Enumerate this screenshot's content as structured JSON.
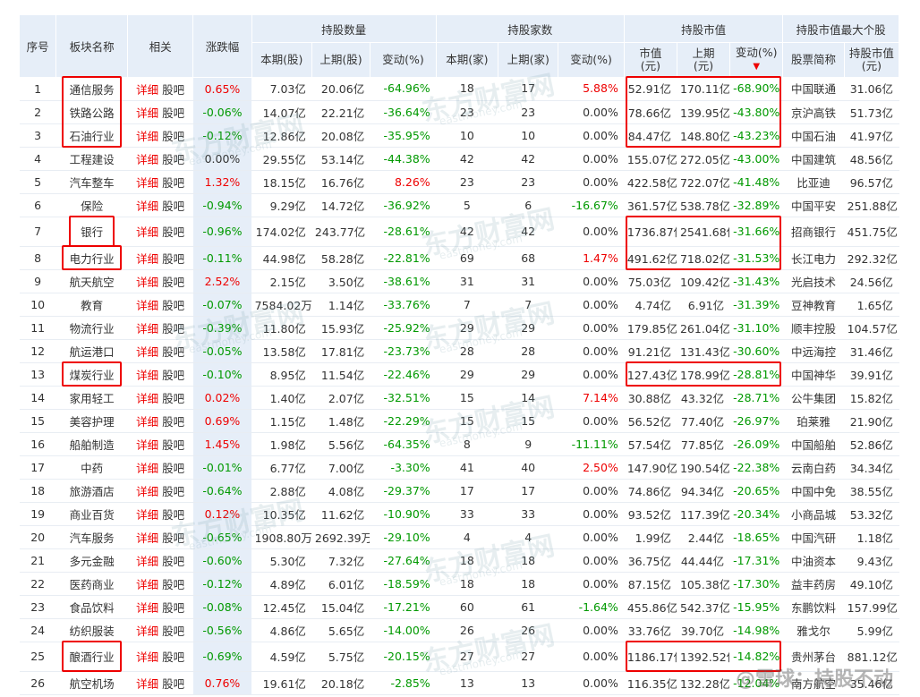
{
  "headers": {
    "seq": "序号",
    "name": "板块名称",
    "related": "相关",
    "change": "涨跌幅",
    "group_shares": "持股数量",
    "group_holders": "持股家数",
    "group_value": "持股市值",
    "group_top": "持股市值最大个股",
    "cur_shares": "本期(股)",
    "prev_shares": "上期(股)",
    "chg_shares": "变动(%)",
    "cur_holders": "本期(家)",
    "prev_holders": "上期(家)",
    "chg_holders": "变动(%)",
    "cur_value_l1": "市值",
    "cur_value_l2": "(元)",
    "prev_value_l1": "上期",
    "prev_value_l2": "(元)",
    "chg_value": "变动(%)",
    "sort_icon": "sort-desc-icon",
    "stock_name": "股票简称",
    "stock_value_l1": "持股市值",
    "stock_value_l2": "(元)"
  },
  "links": {
    "detail": "详细",
    "forum": "股吧"
  },
  "rows": [
    {
      "seq": "1",
      "name": "通信服务",
      "change": "0.65%",
      "cur_shares": "7.03亿",
      "prev_shares": "20.06亿",
      "chg_shares": "-64.96%",
      "cur_holders": "18",
      "prev_holders": "17",
      "chg_holders": "5.88%",
      "cur_value": "52.91亿",
      "prev_value": "170.11亿",
      "chg_value": "-68.90%",
      "stock": "中国联通",
      "stock_value": "31.06亿"
    },
    {
      "seq": "2",
      "name": "铁路公路",
      "change": "-0.06%",
      "cur_shares": "14.07亿",
      "prev_shares": "22.21亿",
      "chg_shares": "-36.64%",
      "cur_holders": "23",
      "prev_holders": "23",
      "chg_holders": "0.00%",
      "cur_value": "78.66亿",
      "prev_value": "139.95亿",
      "chg_value": "-43.80%",
      "stock": "京沪高铁",
      "stock_value": "51.73亿"
    },
    {
      "seq": "3",
      "name": "石油行业",
      "change": "-0.12%",
      "cur_shares": "12.86亿",
      "prev_shares": "20.08亿",
      "chg_shares": "-35.95%",
      "cur_holders": "10",
      "prev_holders": "10",
      "chg_holders": "0.00%",
      "cur_value": "84.47亿",
      "prev_value": "148.80亿",
      "chg_value": "-43.23%",
      "stock": "中国石油",
      "stock_value": "41.97亿"
    },
    {
      "seq": "4",
      "name": "工程建设",
      "change": "0.00%",
      "cur_shares": "29.55亿",
      "prev_shares": "53.14亿",
      "chg_shares": "-44.38%",
      "cur_holders": "42",
      "prev_holders": "42",
      "chg_holders": "0.00%",
      "cur_value": "155.07亿",
      "prev_value": "272.05亿",
      "chg_value": "-43.00%",
      "stock": "中国建筑",
      "stock_value": "48.56亿"
    },
    {
      "seq": "5",
      "name": "汽车整车",
      "change": "1.32%",
      "cur_shares": "18.15亿",
      "prev_shares": "16.76亿",
      "chg_shares": "8.26%",
      "cur_holders": "23",
      "prev_holders": "23",
      "chg_holders": "0.00%",
      "cur_value": "422.58亿",
      "prev_value": "722.07亿",
      "chg_value": "-41.48%",
      "stock": "比亚迪",
      "stock_value": "96.57亿"
    },
    {
      "seq": "6",
      "name": "保险",
      "change": "-0.94%",
      "cur_shares": "9.29亿",
      "prev_shares": "14.72亿",
      "chg_shares": "-36.92%",
      "cur_holders": "5",
      "prev_holders": "6",
      "chg_holders": "-16.67%",
      "cur_value": "361.57亿",
      "prev_value": "538.78亿",
      "chg_value": "-32.89%",
      "stock": "中国平安",
      "stock_value": "251.88亿"
    },
    {
      "seq": "7",
      "name": "银行",
      "change": "-0.96%",
      "cur_shares": "174.02亿",
      "prev_shares": "243.77亿",
      "chg_shares": "-28.61%",
      "cur_holders": "42",
      "prev_holders": "42",
      "chg_holders": "0.00%",
      "cur_value": "1736.87亿",
      "prev_value": "2541.68亿",
      "chg_value": "-31.66%",
      "stock": "招商银行",
      "stock_value": "451.75亿",
      "tall": true
    },
    {
      "seq": "8",
      "name": "电力行业",
      "change": "-0.11%",
      "cur_shares": "44.98亿",
      "prev_shares": "58.28亿",
      "chg_shares": "-22.81%",
      "cur_holders": "69",
      "prev_holders": "68",
      "chg_holders": "1.47%",
      "cur_value": "491.62亿",
      "prev_value": "718.02亿",
      "chg_value": "-31.53%",
      "stock": "长江电力",
      "stock_value": "292.32亿"
    },
    {
      "seq": "9",
      "name": "航天航空",
      "change": "2.52%",
      "cur_shares": "2.15亿",
      "prev_shares": "3.50亿",
      "chg_shares": "-38.61%",
      "cur_holders": "31",
      "prev_holders": "31",
      "chg_holders": "0.00%",
      "cur_value": "75.03亿",
      "prev_value": "109.42亿",
      "chg_value": "-31.43%",
      "stock": "光启技术",
      "stock_value": "24.56亿"
    },
    {
      "seq": "10",
      "name": "教育",
      "change": "-0.07%",
      "cur_shares": "7584.02万",
      "prev_shares": "1.14亿",
      "chg_shares": "-33.76%",
      "cur_holders": "7",
      "prev_holders": "7",
      "chg_holders": "0.00%",
      "cur_value": "4.74亿",
      "prev_value": "6.91亿",
      "chg_value": "-31.39%",
      "stock": "豆神教育",
      "stock_value": "1.65亿"
    },
    {
      "seq": "11",
      "name": "物流行业",
      "change": "-0.39%",
      "cur_shares": "11.80亿",
      "prev_shares": "15.93亿",
      "chg_shares": "-25.92%",
      "cur_holders": "29",
      "prev_holders": "29",
      "chg_holders": "0.00%",
      "cur_value": "179.85亿",
      "prev_value": "261.04亿",
      "chg_value": "-31.10%",
      "stock": "顺丰控股",
      "stock_value": "104.57亿"
    },
    {
      "seq": "12",
      "name": "航运港口",
      "change": "-0.05%",
      "cur_shares": "13.58亿",
      "prev_shares": "17.81亿",
      "chg_shares": "-23.73%",
      "cur_holders": "28",
      "prev_holders": "28",
      "chg_holders": "0.00%",
      "cur_value": "91.21亿",
      "prev_value": "131.43亿",
      "chg_value": "-30.60%",
      "stock": "中远海控",
      "stock_value": "31.46亿"
    },
    {
      "seq": "13",
      "name": "煤炭行业",
      "change": "-0.10%",
      "cur_shares": "8.95亿",
      "prev_shares": "11.54亿",
      "chg_shares": "-22.46%",
      "cur_holders": "29",
      "prev_holders": "29",
      "chg_holders": "0.00%",
      "cur_value": "127.43亿",
      "prev_value": "178.99亿",
      "chg_value": "-28.81%",
      "stock": "中国神华",
      "stock_value": "39.91亿"
    },
    {
      "seq": "14",
      "name": "家用轻工",
      "change": "0.02%",
      "cur_shares": "1.40亿",
      "prev_shares": "2.07亿",
      "chg_shares": "-32.51%",
      "cur_holders": "15",
      "prev_holders": "14",
      "chg_holders": "7.14%",
      "cur_value": "30.88亿",
      "prev_value": "43.32亿",
      "chg_value": "-28.71%",
      "stock": "公牛集团",
      "stock_value": "15.82亿"
    },
    {
      "seq": "15",
      "name": "美容护理",
      "change": "0.69%",
      "cur_shares": "1.15亿",
      "prev_shares": "1.48亿",
      "chg_shares": "-22.29%",
      "cur_holders": "15",
      "prev_holders": "15",
      "chg_holders": "0.00%",
      "cur_value": "56.52亿",
      "prev_value": "77.40亿",
      "chg_value": "-26.97%",
      "stock": "珀莱雅",
      "stock_value": "21.90亿"
    },
    {
      "seq": "16",
      "name": "船舶制造",
      "change": "1.45%",
      "cur_shares": "1.98亿",
      "prev_shares": "5.56亿",
      "chg_shares": "-64.35%",
      "cur_holders": "8",
      "prev_holders": "9",
      "chg_holders": "-11.11%",
      "cur_value": "57.54亿",
      "prev_value": "77.85亿",
      "chg_value": "-26.09%",
      "stock": "中国船舶",
      "stock_value": "52.86亿"
    },
    {
      "seq": "17",
      "name": "中药",
      "change": "-0.01%",
      "cur_shares": "6.77亿",
      "prev_shares": "7.00亿",
      "chg_shares": "-3.30%",
      "cur_holders": "41",
      "prev_holders": "40",
      "chg_holders": "2.50%",
      "cur_value": "147.90亿",
      "prev_value": "190.54亿",
      "chg_value": "-22.38%",
      "stock": "云南白药",
      "stock_value": "34.34亿"
    },
    {
      "seq": "18",
      "name": "旅游酒店",
      "change": "-0.64%",
      "cur_shares": "2.88亿",
      "prev_shares": "4.08亿",
      "chg_shares": "-29.37%",
      "cur_holders": "17",
      "prev_holders": "17",
      "chg_holders": "0.00%",
      "cur_value": "74.86亿",
      "prev_value": "94.34亿",
      "chg_value": "-20.65%",
      "stock": "中国中免",
      "stock_value": "38.55亿"
    },
    {
      "seq": "19",
      "name": "商业百货",
      "change": "0.12%",
      "cur_shares": "10.35亿",
      "prev_shares": "11.62亿",
      "chg_shares": "-10.90%",
      "cur_holders": "33",
      "prev_holders": "33",
      "chg_holders": "0.00%",
      "cur_value": "93.52亿",
      "prev_value": "117.39亿",
      "chg_value": "-20.34%",
      "stock": "小商品城",
      "stock_value": "53.32亿"
    },
    {
      "seq": "20",
      "name": "汽车服务",
      "change": "-0.65%",
      "cur_shares": "1908.80万",
      "prev_shares": "2692.39万",
      "chg_shares": "-29.10%",
      "cur_holders": "4",
      "prev_holders": "4",
      "chg_holders": "0.00%",
      "cur_value": "1.99亿",
      "prev_value": "2.44亿",
      "chg_value": "-18.65%",
      "stock": "中国汽研",
      "stock_value": "1.18亿"
    },
    {
      "seq": "21",
      "name": "多元金融",
      "change": "-0.60%",
      "cur_shares": "5.30亿",
      "prev_shares": "7.32亿",
      "chg_shares": "-27.64%",
      "cur_holders": "18",
      "prev_holders": "18",
      "chg_holders": "0.00%",
      "cur_value": "36.75亿",
      "prev_value": "44.44亿",
      "chg_value": "-17.31%",
      "stock": "中油资本",
      "stock_value": "9.43亿"
    },
    {
      "seq": "22",
      "name": "医药商业",
      "change": "-0.12%",
      "cur_shares": "4.89亿",
      "prev_shares": "6.01亿",
      "chg_shares": "-18.59%",
      "cur_holders": "18",
      "prev_holders": "18",
      "chg_holders": "0.00%",
      "cur_value": "87.15亿",
      "prev_value": "105.38亿",
      "chg_value": "-17.30%",
      "stock": "益丰药房",
      "stock_value": "49.10亿"
    },
    {
      "seq": "23",
      "name": "食品饮料",
      "change": "-0.08%",
      "cur_shares": "12.45亿",
      "prev_shares": "15.04亿",
      "chg_shares": "-17.21%",
      "cur_holders": "60",
      "prev_holders": "61",
      "chg_holders": "-1.64%",
      "cur_value": "455.86亿",
      "prev_value": "542.37亿",
      "chg_value": "-15.95%",
      "stock": "东鹏饮料",
      "stock_value": "157.99亿"
    },
    {
      "seq": "24",
      "name": "纺织服装",
      "change": "-0.56%",
      "cur_shares": "4.86亿",
      "prev_shares": "5.65亿",
      "chg_shares": "-14.00%",
      "cur_holders": "26",
      "prev_holders": "26",
      "chg_holders": "0.00%",
      "cur_value": "33.76亿",
      "prev_value": "39.70亿",
      "chg_value": "-14.98%",
      "stock": "雅戈尔",
      "stock_value": "5.99亿"
    },
    {
      "seq": "25",
      "name": "酿酒行业",
      "change": "-0.69%",
      "cur_shares": "4.59亿",
      "prev_shares": "5.75亿",
      "chg_shares": "-20.15%",
      "cur_holders": "27",
      "prev_holders": "27",
      "chg_holders": "0.00%",
      "cur_value": "1186.17亿",
      "prev_value": "1392.52亿",
      "chg_value": "-14.82%",
      "stock": "贵州茅台",
      "stock_value": "881.12亿",
      "tall": true
    },
    {
      "seq": "26",
      "name": "航空机场",
      "change": "0.76%",
      "cur_shares": "19.61亿",
      "prev_shares": "20.18亿",
      "chg_shares": "-2.85%",
      "cur_holders": "13",
      "prev_holders": "13",
      "chg_holders": "0.00%",
      "cur_value": "116.35亿",
      "prev_value": "132.28亿",
      "chg_value": "-12.04%",
      "stock": "南方航空",
      "stock_value": "35.46亿"
    }
  ],
  "watermark": {
    "brand": "东方财富网",
    "site": "eastmoney.com"
  },
  "corner_mark": "@雪球：持股不动",
  "colors": {
    "up": "#ee0000",
    "down": "#009900",
    "header_bg": "#e6eef8",
    "highlight": "#ee0000"
  }
}
